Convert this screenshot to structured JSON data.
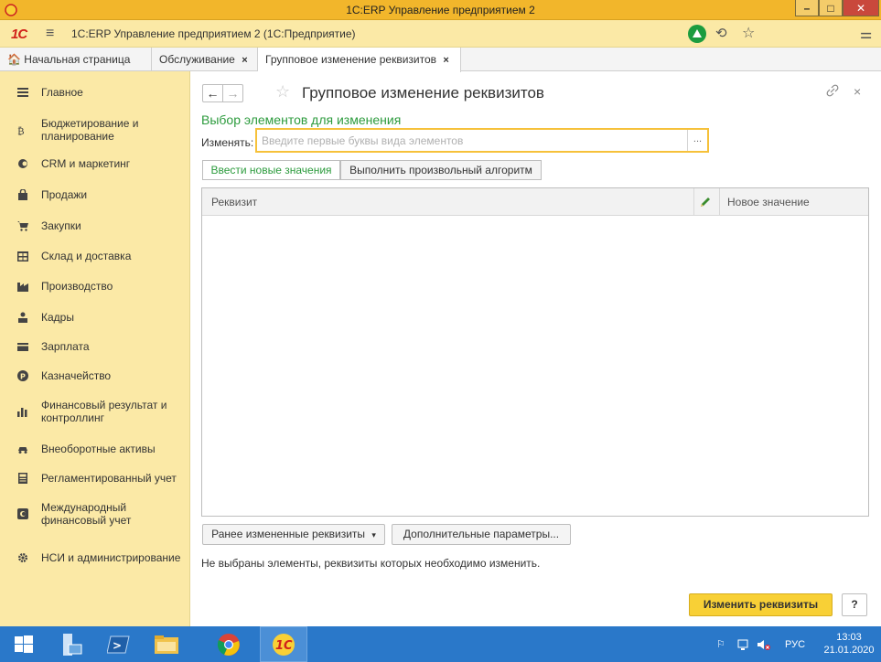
{
  "window": {
    "title": "1С:ERP Управление предприятием 2",
    "min": "–",
    "max": "□",
    "close": "✕"
  },
  "app": {
    "logo": "1С",
    "title": "1С:ERP Управление предприятием 2  (1С:Предприятие)",
    "icons": [
      "burger-menu-icon",
      "notification-icon",
      "history-icon",
      "favorites-star-icon",
      "main-menu-icon"
    ]
  },
  "tabs": {
    "home": "Начальная страница",
    "items": [
      {
        "label": "Обслуживание",
        "close": "×"
      },
      {
        "label": "Групповое изменение реквизитов",
        "close": "×"
      }
    ]
  },
  "sidebar": {
    "items": [
      {
        "label": "Главное",
        "icon": "menu-lines-icon"
      },
      {
        "label": "Бюджетирование и планирование",
        "icon": "budget-icon"
      },
      {
        "label": "CRM и маркетинг",
        "icon": "crm-icon"
      },
      {
        "label": "Продажи",
        "icon": "bag-icon"
      },
      {
        "label": "Закупки",
        "icon": "cart-icon"
      },
      {
        "label": "Склад и доставка",
        "icon": "warehouse-icon"
      },
      {
        "label": "Производство",
        "icon": "factory-icon"
      },
      {
        "label": "Кадры",
        "icon": "person-icon"
      },
      {
        "label": "Зарплата",
        "icon": "wallet-icon"
      },
      {
        "label": "Казначейство",
        "icon": "treasury-icon"
      },
      {
        "label": "Финансовый результат и контроллинг",
        "icon": "bar-chart-icon"
      },
      {
        "label": "Внеоборотные активы",
        "icon": "car-icon"
      },
      {
        "label": "Регламентированный учет",
        "icon": "calculator-icon"
      },
      {
        "label": "Международный финансовый учет",
        "icon": "intl-finance-icon"
      },
      {
        "label": "НСИ и администрирование",
        "icon": "gear-icon"
      }
    ]
  },
  "form": {
    "back": "←",
    "forward": "→",
    "star": "☆",
    "title": "Групповое изменение реквизитов",
    "link": "🔗",
    "close": "×",
    "section_title": "Выбор элементов для изменения",
    "field_label": "Изменять:",
    "field_placeholder": "Введите первые буквы вида элементов",
    "field_value": "",
    "pick": "...",
    "mode_buttons": [
      "Ввести новые значения",
      "Выполнить произвольный алгоритм"
    ],
    "table": {
      "col1": "Реквизит",
      "col2": "Новое значение",
      "rows": []
    },
    "prev_button": "Ранее измененные реквизиты",
    "dropdown_arrow": "▾",
    "adv_button": "Дополнительные параметры...",
    "info": "Не выбраны элементы, реквизиты которых необходимо изменить.",
    "primary_button": "Изменить реквизиты",
    "help_button": "?"
  },
  "taskbar": {
    "lang": "РУС",
    "time": "13:03",
    "date": "21.01.2020"
  },
  "colors": {
    "accent_yellow": "#f8d036",
    "panel_yellow": "#fbe9a6",
    "green": "#2c9b3d",
    "taskbar": "#2a78c9"
  }
}
